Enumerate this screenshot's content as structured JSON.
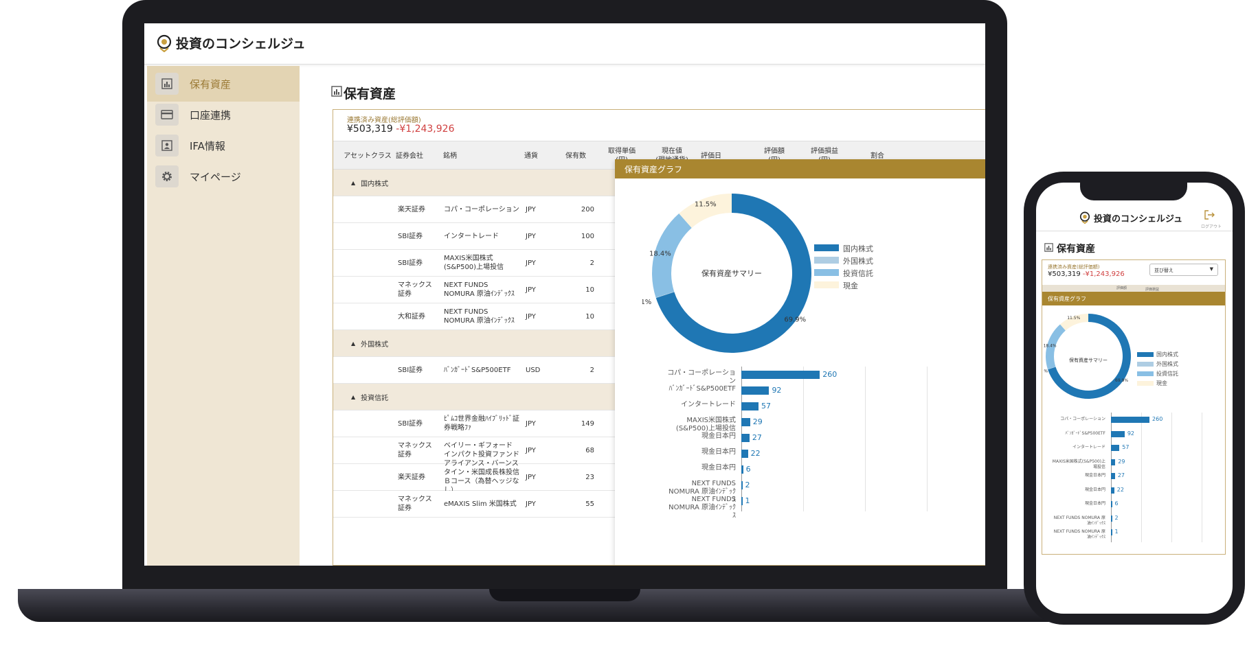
{
  "app": {
    "title": "投資のコンシェルジュ"
  },
  "sidebar": {
    "items": [
      {
        "label": "保有資産",
        "icon": "chart-icon",
        "active": true
      },
      {
        "label": "口座連携",
        "icon": "card-icon",
        "active": false
      },
      {
        "label": "IFA情報",
        "icon": "profile-icon",
        "active": false
      },
      {
        "label": "マイページ",
        "icon": "gear-icon",
        "active": false
      }
    ]
  },
  "page": {
    "title": "保有資産"
  },
  "summary": {
    "label": "連携済み資産(総評価額)",
    "value": "¥503,319",
    "diff": "-¥1,243,926"
  },
  "table": {
    "headers": [
      "アセットクラス",
      "証券会社",
      "銘柄",
      "通貨",
      "保有数",
      "取得単価\n(円)",
      "現在値\n(現地通貨)",
      "評価日",
      "評価額\n(円)",
      "評価損益\n(円)",
      "割合"
    ],
    "rows": [
      {
        "type": "group",
        "label": "国内株式"
      },
      {
        "type": "item",
        "broker": "楽天証券",
        "name": "コパ・コーポレーション",
        "currency": "JPY",
        "qty": "200"
      },
      {
        "type": "item",
        "broker": "SBI証券",
        "name": "インタートレード",
        "currency": "JPY",
        "qty": "100"
      },
      {
        "type": "item",
        "broker": "SBI証券",
        "name": "MAXIS米国株式(S&P500)上場投信",
        "currency": "JPY",
        "qty": "2"
      },
      {
        "type": "item",
        "broker": "マネックス証券",
        "name": "NEXT FUNDS NOMURA 原油ｲﾝﾃﾞｯｸｽ",
        "currency": "JPY",
        "qty": "10"
      },
      {
        "type": "item",
        "broker": "大和証券",
        "name": "NEXT FUNDS NOMURA 原油ｲﾝﾃﾞｯｸｽ",
        "currency": "JPY",
        "qty": "10"
      },
      {
        "type": "group",
        "label": "外国株式"
      },
      {
        "type": "item",
        "broker": "SBI証券",
        "name": "ﾊﾞﾝｶﾞｰﾄﾞS&P500ETF",
        "currency": "USD",
        "qty": "2"
      },
      {
        "type": "group",
        "label": "投資信託"
      },
      {
        "type": "item",
        "broker": "SBI証券",
        "name": "ﾋﾟﾑｺ世界金融ﾊｲﾌﾞﾘｯﾄﾞ証券戦略ﾌｧ",
        "currency": "JPY",
        "qty": "149"
      },
      {
        "type": "item",
        "broker": "マネックス証券",
        "name": "ベイリー・ギフォード インパクト投資ファンド",
        "currency": "JPY",
        "qty": "68"
      },
      {
        "type": "item",
        "broker": "楽天証券",
        "name": "アライアンス・バーンスタイン・米国成長株投信Ｂコース（為替ヘッジなし）",
        "currency": "JPY",
        "qty": "23"
      },
      {
        "type": "item",
        "broker": "マネックス証券",
        "name": "eMAXIS Slim 米国株式",
        "currency": "JPY",
        "qty": "55"
      }
    ]
  },
  "graph": {
    "title": "保有資産グラフ"
  },
  "phone": {
    "logout": "ログアウト",
    "sort_label": "並び替え",
    "head_cols": [
      "評価額",
      "評価損益"
    ]
  },
  "chart_data": [
    {
      "type": "pie",
      "title": "保有資産サマリー",
      "categories": [
        "国内株式",
        "外国株式",
        "投資信託",
        "現金"
      ],
      "values": [
        69.9,
        0.1,
        18.4,
        11.5
      ],
      "value_labels": [
        "69.9%",
        "0.1%",
        "18.4%",
        "11.5%"
      ],
      "colors": [
        "#1f77b4",
        "#aecde3",
        "#89bfe4",
        "#fdf3dc"
      ],
      "legend": "right"
    },
    {
      "type": "bar",
      "orientation": "horizontal",
      "categories": [
        "コパ・コーポレーション",
        "ﾊﾞﾝｶﾞｰﾄﾞS&P500ETF",
        "インタートレード",
        "MAXIS米国株式(S&P500)上場投信",
        "現金日本円",
        "現金日本円",
        "現金日本円",
        "NEXT FUNDS NOMURA 原油ｲﾝﾃﾞｯｸｽ",
        "NEXT FUNDS NOMURA 原油ｲﾝﾃﾞｯｸｽ"
      ],
      "values": [
        260,
        92,
        57,
        29,
        27,
        22,
        6,
        2,
        1
      ],
      "xlim": [
        0,
        580
      ],
      "grid": true,
      "color": "#1f77b4"
    }
  ]
}
